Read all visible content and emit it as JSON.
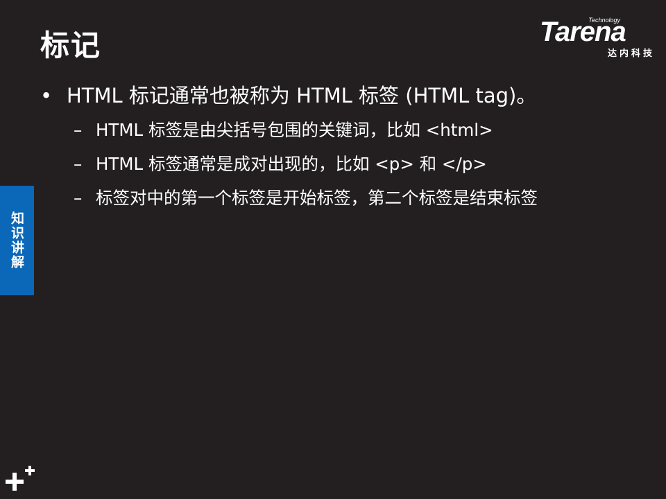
{
  "slide": {
    "title": "标记"
  },
  "logo": {
    "tagline": "Technology",
    "wordmark": "Tarena",
    "company_cn": "达内科技"
  },
  "bullets": [
    {
      "text": "HTML 标记通常也被称为 HTML 标签 (HTML tag)。",
      "sub": [
        "HTML 标签是由尖括号包围的关键词，比如 <html>",
        "HTML 标签通常是成对出现的，比如 <p> 和 </p>",
        "标签对中的第一个标签是开始标签，第二个标签是结束标签"
      ]
    }
  ],
  "markers": {
    "bullet": "•",
    "dash": "–"
  },
  "side_tab": {
    "label": "知识讲解"
  },
  "icons": {
    "corner": "plus-icon"
  },
  "colors": {
    "background": "#231f20",
    "side_tab": "#0b67b8",
    "text": "#ffffff"
  }
}
